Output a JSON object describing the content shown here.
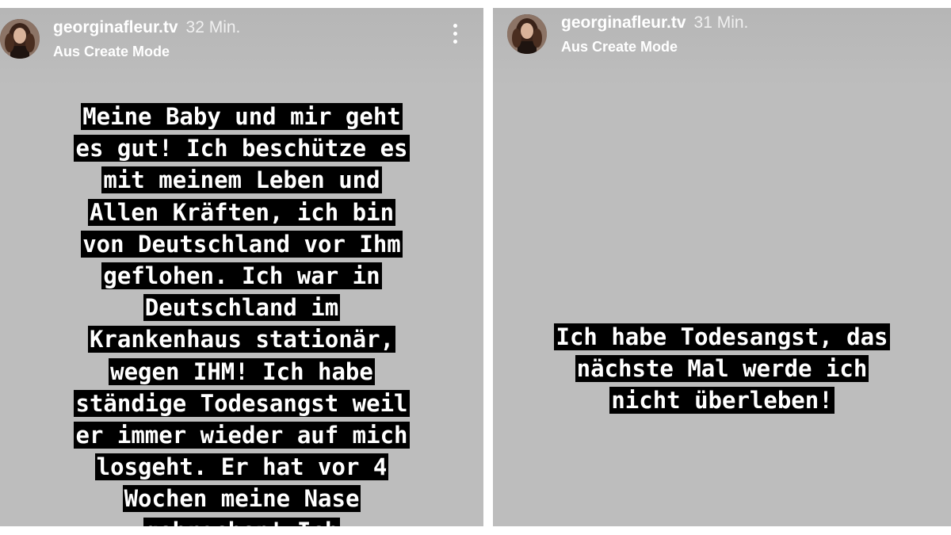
{
  "stories": [
    {
      "username": "georginafleur.tv",
      "timestamp": "32 Min.",
      "subtitle": "Aus Create Mode",
      "has_more_menu": true,
      "lines": [
        "Meine Baby und mir geht",
        "es gut! Ich beschütze es",
        "mit meinem Leben und",
        "Allen Kräften, ich bin",
        "von Deutschland vor Ihm",
        "geflohen. Ich war in",
        "Deutschland im",
        "Krankenhaus stationär,",
        "wegen IHM! Ich habe",
        "ständige Todesangst weil",
        "er immer wieder auf mich",
        "losgeht. Er hat vor 4",
        "Wochen meine Nase",
        "gebrochen! Ich"
      ]
    },
    {
      "username": "georginafleur.tv",
      "timestamp": "31 Min.",
      "subtitle": "Aus Create Mode",
      "has_more_menu": false,
      "lines": [
        "Ich habe Todesangst, das",
        "nächste Mal werde ich",
        "nicht überleben!"
      ]
    }
  ],
  "icons": {
    "avatar": "profile-photo",
    "more": "vertical-ellipsis-icon"
  },
  "colors": {
    "background": "#bdbdbd",
    "text_highlight": "#000000",
    "text": "#ffffff"
  }
}
